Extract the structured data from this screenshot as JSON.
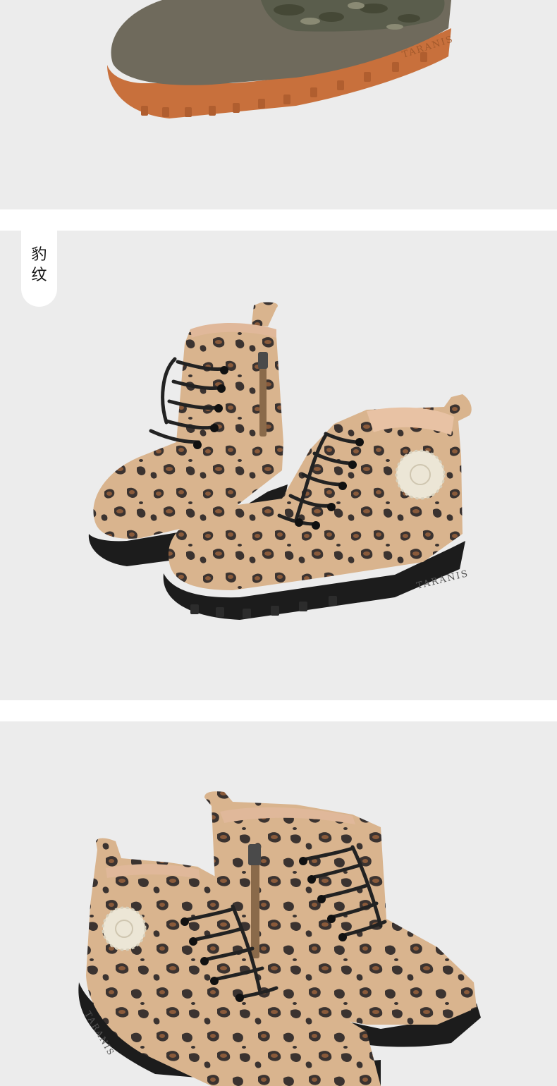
{
  "panels": [
    {
      "id": "camo-boot-detail",
      "brand_mark": "TARANIS"
    },
    {
      "id": "leopard-boots-pair-1",
      "color_tag": "豹纹",
      "brand_mark": "TARANIS"
    },
    {
      "id": "leopard-boots-pair-2",
      "brand_mark": "TARANIS"
    }
  ],
  "colors": {
    "page_background": "#ffffff",
    "panel_background": "#ececec",
    "tag_background": "#ffffff",
    "suede_grey": "#6f6a5c",
    "rubber_sole_orange": "#c8703c",
    "leopard_base": "#d9b48e",
    "leopard_spot_dark": "#3b3330",
    "leopard_spot_brown": "#8a5a3a",
    "sole_black": "#1c1c1c",
    "lace_black": "#222222",
    "patch_cream": "#ece6d6"
  }
}
